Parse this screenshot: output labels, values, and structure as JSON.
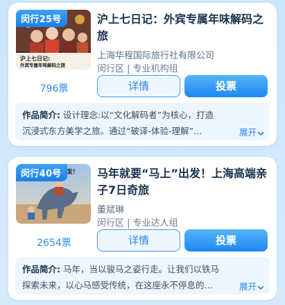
{
  "cards": [
    {
      "badge": "闵行25号",
      "title": "沪上七日记：外宾专属年味解码之旅",
      "org": "上海华程国际旅行社有限公司",
      "meta": "闵行区 | 专业机构组",
      "votes": "796票",
      "detail_label": "详情",
      "vote_label": "投票",
      "intro_label": "作品简介:",
      "intro_line1": " 设计理念:以“文化解码者”为核心，打造",
      "intro_line2": "沉浸式东方美学之旅。通过“破译-体验-理解”…",
      "expand_label": "展开",
      "expand_icon": "chevron-down-icon",
      "thumb_caption": "沪上七日记:",
      "thumb_caption2": "外宾专属年味解码之旅"
    },
    {
      "badge": "闵行40号",
      "title": "马年就要“马上”出发！上海高端亲子7日奇旅",
      "org": "董斌琳",
      "meta": "闵行区 | 专业达人组",
      "votes": "2654票",
      "detail_label": "详情",
      "vote_label": "投票",
      "intro_label": "作品简介:",
      "intro_line1": " 马年，当以骏马之姿行走。让我们以铁马",
      "intro_line2": "探索未来，以心马感受传统，在这座永不停息的…",
      "expand_label": "展开",
      "expand_icon": "chevron-down-icon",
      "thumb_caption": "马年就要马上出发！"
    }
  ],
  "colors": {
    "accent": "#2a86e0",
    "badge": "#1c7fe6",
    "title": "#17314f",
    "background": "#cfe6fb"
  }
}
